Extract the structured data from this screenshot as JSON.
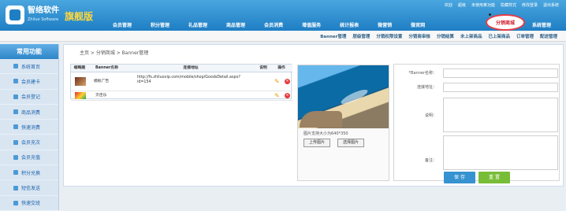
{
  "app": {
    "brand": "智络软件",
    "brand_sub": "Zhiluo Software",
    "edition": "旗舰版"
  },
  "top_links": [
    "欢迎",
    "超级",
    "未使用某功能",
    "隐藏样式",
    "修改登录",
    "退出系统"
  ],
  "main_nav": [
    "会员管理",
    "积分管理",
    "礼品管理",
    "商品管理",
    "会员消费",
    "增值服务",
    "统计报表",
    "微营销",
    "微官网",
    "分销商城",
    "系统管理"
  ],
  "active_nav": "分销商城",
  "sub_nav": [
    "Banner管理",
    "层级管理",
    "分销权限设置",
    "分销商审核",
    "分销结算",
    "未上架商品",
    "已上架商品",
    "订单管理",
    "配送管理"
  ],
  "sidebar": {
    "title": "常用功能",
    "items": [
      "系统首页",
      "会员建卡",
      "会员登记",
      "商品消费",
      "快速消费",
      "会员充次",
      "会员充值",
      "积分兑换",
      "短信发送",
      "快速交班"
    ]
  },
  "breadcrumb": "主页  >  分销商城  >  Banner管理",
  "table": {
    "headers": [
      "缩略图",
      "Banner名称",
      "连接地址",
      "说明",
      "操作"
    ],
    "rows": [
      {
        "name": "模板广告",
        "url": "http://fs.zhiluovip.com/mobile/shop/GoodsDetail.aspx?id=154",
        "desc": ""
      },
      {
        "name": "贝佳乐",
        "url": "",
        "desc": ""
      }
    ]
  },
  "image_panel": {
    "tip": "图片支持大小为640*350",
    "upload": "上传图片",
    "choose": "选择图片"
  },
  "form": {
    "labels": [
      "*Banner名称：",
      "连接地址：",
      "说明：",
      "备注："
    ],
    "save": "保 存",
    "reset": "重 置"
  }
}
